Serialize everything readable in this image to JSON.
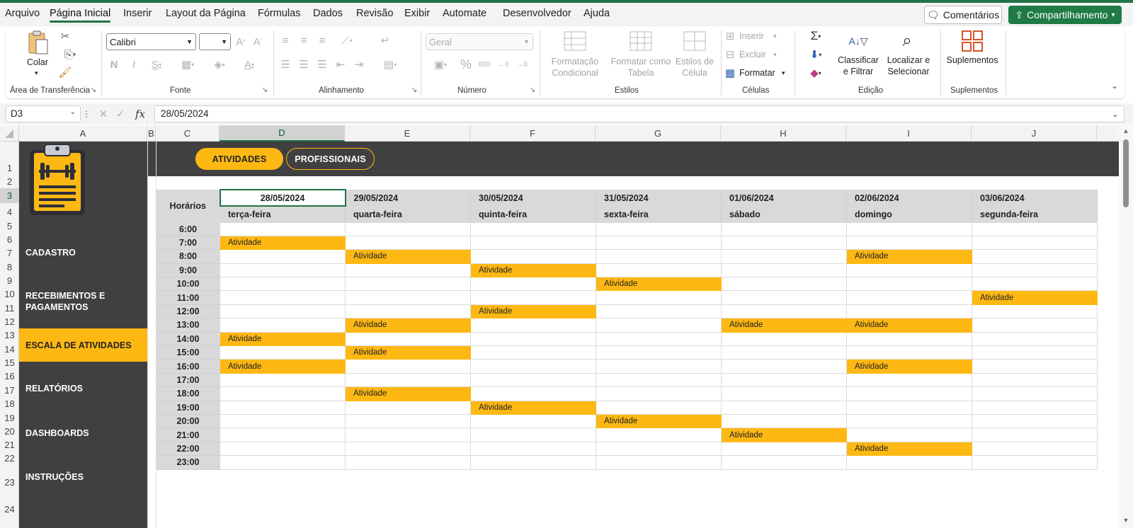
{
  "menu": {
    "items": [
      "Arquivo",
      "Página Inicial",
      "Inserir",
      "Layout da Página",
      "Fórmulas",
      "Dados",
      "Revisão",
      "Exibir",
      "Automate",
      "Desenvolvedor",
      "Ajuda"
    ],
    "active": "Página Inicial",
    "comments_label": "Comentários",
    "share_label": "Compartilhamento"
  },
  "ribbon": {
    "clipboard": {
      "paste_label": "Colar",
      "group_label": "Área de Transferência"
    },
    "font": {
      "font_name": "Calibri",
      "font_size": "",
      "group_label": "Fonte"
    },
    "alignment": {
      "group_label": "Alinhamento"
    },
    "number": {
      "format": "Geral",
      "group_label": "Número"
    },
    "styles": {
      "conditional_l1": "Formatação",
      "conditional_l2": "Condicional",
      "table_l1": "Formatar como",
      "table_l2": "Tabela",
      "cell_l1": "Estilos de",
      "cell_l2": "Célula",
      "group_label": "Estilos"
    },
    "cells": {
      "insert_label": "Inserir",
      "delete_label": "Excluir",
      "format_label": "Formatar",
      "group_label": "Células"
    },
    "editing": {
      "sort_l1": "Classificar",
      "sort_l2": "e Filtrar",
      "find_l1": "Localizar e",
      "find_l2": "Selecionar",
      "group_label": "Edição"
    },
    "addins": {
      "label": "Suplementos",
      "group_label": "Suplementos"
    }
  },
  "formula_bar": {
    "name_box": "D3",
    "fx": "fx",
    "formula": "28/05/2024"
  },
  "columns": [
    "A",
    "B",
    "C",
    "D",
    "E",
    "F",
    "G",
    "H",
    "I",
    "J"
  ],
  "selected_column": "D",
  "rows": [
    "1",
    "2",
    "3",
    "4",
    "5",
    "6",
    "7",
    "8",
    "9",
    "10",
    "11",
    "12",
    "13",
    "14",
    "15",
    "16",
    "17",
    "18",
    "19",
    "20",
    "21",
    "22",
    "23",
    "24"
  ],
  "selected_row": "3",
  "tabs": {
    "atividades": "ATIVIDADES",
    "profissionais": "PROFISSIONAIS"
  },
  "nav": {
    "cadastro": "CADASTRO",
    "recebimentos_l1": "RECEBIMENTOS E",
    "recebimentos_l2": "PAGAMENTOS",
    "escala": "ESCALA DE ATIVIDADES",
    "relatorios": "RELATÓRIOS",
    "dashboards": "DASHBOARDS",
    "instrucoes": "INSTRUÇÕES"
  },
  "schedule": {
    "hours_header": "Horários",
    "dates": [
      "28/05/2024",
      "29/05/2024",
      "30/05/2024",
      "31/05/2024",
      "01/06/2024",
      "02/06/2024",
      "03/06/2024"
    ],
    "weekdays": [
      "terça-feira",
      "quarta-feira",
      "quinta-feira",
      "sexta-feira",
      "sábado",
      "domingo",
      "segunda-feira"
    ],
    "hours": [
      "6:00",
      "7:00",
      "8:00",
      "9:00",
      "10:00",
      "11:00",
      "12:00",
      "13:00",
      "14:00",
      "15:00",
      "16:00",
      "17:00",
      "18:00",
      "19:00",
      "20:00",
      "21:00",
      "22:00",
      "23:00"
    ],
    "activity_label": "Atividade",
    "grid": [
      [
        0,
        0,
        0,
        0,
        0,
        0,
        0
      ],
      [
        1,
        0,
        0,
        0,
        0,
        0,
        0
      ],
      [
        0,
        1,
        0,
        0,
        0,
        1,
        0
      ],
      [
        0,
        0,
        1,
        0,
        0,
        0,
        0
      ],
      [
        0,
        0,
        0,
        1,
        0,
        0,
        0
      ],
      [
        0,
        0,
        0,
        0,
        0,
        0,
        1
      ],
      [
        0,
        0,
        1,
        0,
        0,
        0,
        0
      ],
      [
        0,
        1,
        0,
        0,
        1,
        1,
        0
      ],
      [
        1,
        0,
        0,
        0,
        0,
        0,
        0
      ],
      [
        0,
        1,
        0,
        0,
        0,
        0,
        0
      ],
      [
        1,
        0,
        0,
        0,
        0,
        1,
        0
      ],
      [
        0,
        0,
        0,
        0,
        0,
        0,
        0
      ],
      [
        0,
        1,
        0,
        0,
        0,
        0,
        0
      ],
      [
        0,
        0,
        1,
        0,
        0,
        0,
        0
      ],
      [
        0,
        0,
        0,
        1,
        0,
        0,
        0
      ],
      [
        0,
        0,
        0,
        0,
        1,
        0,
        0
      ],
      [
        0,
        0,
        0,
        0,
        0,
        1,
        0
      ],
      [
        0,
        0,
        0,
        0,
        0,
        0,
        0
      ]
    ]
  },
  "colors": {
    "accent": "#217346",
    "highlight": "#fdb813",
    "panel": "#404040"
  }
}
